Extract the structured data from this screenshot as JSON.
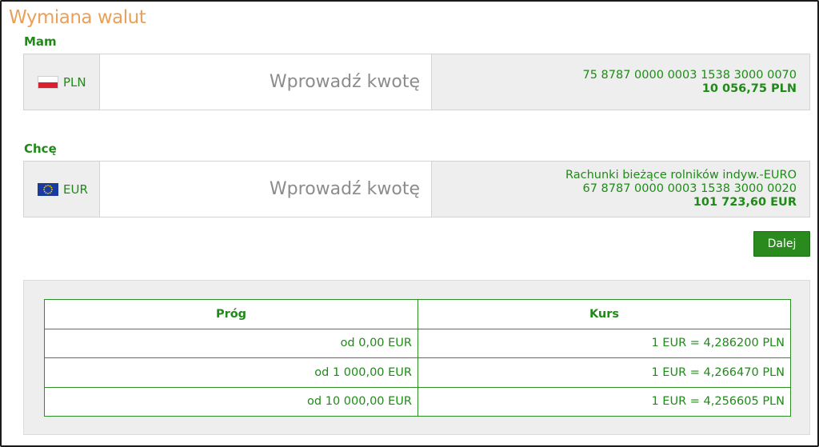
{
  "page": {
    "title": "Wymiana walut"
  },
  "have": {
    "label": "Mam",
    "currency": "PLN",
    "amount_placeholder": "Wprowadź kwotę",
    "account_name": "",
    "account_number": "75 8787 0000 0003 1538 3000 0070",
    "balance": "10 056,75 PLN"
  },
  "want": {
    "label": "Chcę",
    "currency": "EUR",
    "amount_placeholder": "Wprowadź kwotę",
    "account_name": "Rachunki bieżące rolników indyw.-EURO",
    "account_number": "67 8787 0000 0003 1538 3000 0020",
    "balance": "101 723,60 EUR"
  },
  "actions": {
    "next_label": "Dalej"
  },
  "rates_table": {
    "headers": {
      "threshold": "Próg",
      "rate": "Kurs"
    },
    "rows": [
      {
        "threshold": "od 0,00 EUR",
        "rate": "1 EUR = 4,286200 PLN"
      },
      {
        "threshold": "od 1 000,00 EUR",
        "rate": "1 EUR = 4,266470 PLN"
      },
      {
        "threshold": "od 10 000,00 EUR",
        "rate": "1 EUR = 4,256605 PLN"
      }
    ]
  },
  "icons": {
    "have_flag": "poland-flag-icon",
    "want_flag": "eu-flag-icon"
  },
  "colors": {
    "accent_green": "#1f8a18",
    "button_green": "#2a8a1e",
    "title_orange": "#e8a05a",
    "panel_gray": "#eeeeee"
  }
}
